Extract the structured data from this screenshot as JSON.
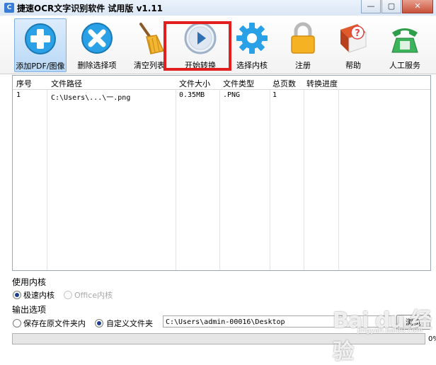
{
  "window": {
    "title": "捷速OCR文字识别软件 试用版 v1.11",
    "controls": [
      "—",
      "▢",
      "✕"
    ]
  },
  "toolbar": {
    "items": [
      {
        "label": "添加PDF/图像",
        "icon": "add-plus-icon"
      },
      {
        "label": "删除选择项",
        "icon": "delete-x-icon"
      },
      {
        "label": "清空列表",
        "icon": "broom-icon"
      },
      {
        "label": "开始转换",
        "icon": "play-icon"
      },
      {
        "label": "选择内核",
        "icon": "gear-icon"
      },
      {
        "label": "注册",
        "icon": "lock-icon"
      },
      {
        "label": "帮助",
        "icon": "help-book-icon"
      },
      {
        "label": "人工服务",
        "icon": "phone-icon"
      }
    ],
    "highlight_color": "#e31e1e"
  },
  "table": {
    "headers": [
      "序号",
      "文件路径",
      "文件大小",
      "文件类型",
      "总页数",
      "转换进度"
    ],
    "rows": [
      [
        "1",
        "C:\\Users\\...\\一.png",
        "0.35MB",
        ".PNG",
        "1",
        ""
      ]
    ]
  },
  "engine": {
    "title": "使用内核",
    "options": [
      {
        "label": "极速内核",
        "selected": true,
        "disabled": false
      },
      {
        "label": "Office内核",
        "selected": false,
        "disabled": true
      }
    ]
  },
  "output": {
    "title": "输出选项",
    "options": [
      {
        "label": "保存在原文件夹内",
        "selected": false
      },
      {
        "label": "自定义文件夹",
        "selected": true
      }
    ],
    "path": "C:\\Users\\admin-00016\\Desktop",
    "browse_label": "浏览"
  },
  "progress": {
    "value": 0,
    "text": "0%"
  },
  "watermark": {
    "main": "Bai du 经验",
    "sub": "jingyan.baidu.com"
  }
}
